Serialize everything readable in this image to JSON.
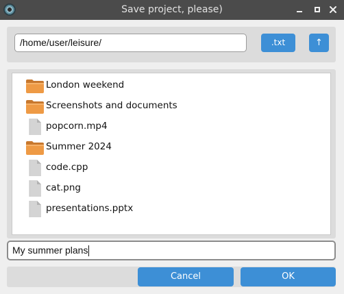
{
  "window": {
    "title": "Save project, please)"
  },
  "path_bar": {
    "path_value": "/home/user/leisure/",
    "extension_label": ".txt",
    "up_label": "↑"
  },
  "files": [
    {
      "name": "London weekend",
      "type": "folder"
    },
    {
      "name": "Screenshots and documents",
      "type": "folder"
    },
    {
      "name": "popcorn.mp4",
      "type": "file"
    },
    {
      "name": "Summer 2024",
      "type": "folder"
    },
    {
      "name": "code.cpp",
      "type": "file"
    },
    {
      "name": "cat.png",
      "type": "file"
    },
    {
      "name": "presentations.pptx",
      "type": "file"
    }
  ],
  "filename_input": {
    "value": "My summer plans"
  },
  "actions": {
    "cancel_label": "Cancel",
    "ok_label": "OK"
  },
  "colors": {
    "accent": "#3d8fd6",
    "folder": "#e8923a",
    "file": "#c9c9c9"
  }
}
